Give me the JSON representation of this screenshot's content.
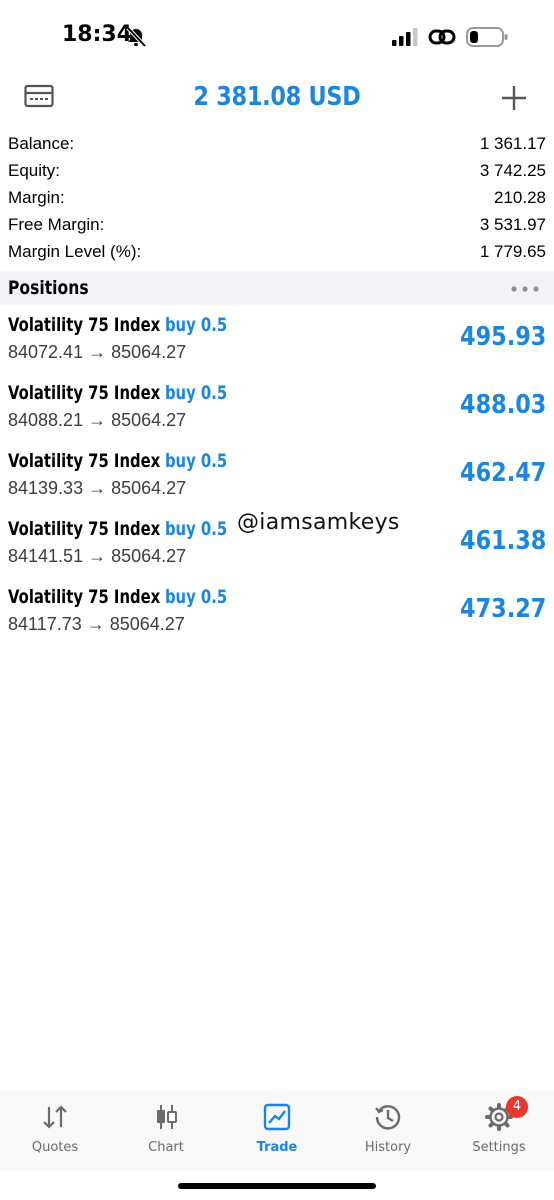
{
  "status_bar": {
    "time": "18:34"
  },
  "header": {
    "title": "2 381.08 USD",
    "accent_color": "#1a86e0"
  },
  "summary": [
    {
      "label": "Balance:",
      "value": "1 361.17"
    },
    {
      "label": "Equity:",
      "value": "3 742.25"
    },
    {
      "label": "Margin:",
      "value": "210.28"
    },
    {
      "label": "Free Margin:",
      "value": "3 531.97"
    },
    {
      "label": "Margin Level (%):",
      "value": "1 779.65"
    }
  ],
  "positions": {
    "title": "Positions",
    "items": [
      {
        "symbol": "Volatility 75 Index",
        "side": "buy 0.5",
        "prices": "84072.41 → 85064.27",
        "profit": "495.93"
      },
      {
        "symbol": "Volatility 75 Index",
        "side": "buy 0.5",
        "prices": "84088.21 → 85064.27",
        "profit": "488.03"
      },
      {
        "symbol": "Volatility 75 Index",
        "side": "buy 0.5",
        "prices": "84139.33 → 85064.27",
        "profit": "462.47"
      },
      {
        "symbol": "Volatility 75 Index",
        "side": "buy 0.5",
        "prices": "84141.51 → 85064.27",
        "profit": "461.38"
      },
      {
        "symbol": "Volatility 75 Index",
        "side": "buy 0.5",
        "prices": "84117.73 → 85064.27",
        "profit": "473.27"
      }
    ]
  },
  "watermark": "@iamsamkeys",
  "tabs": [
    {
      "label": "Quotes",
      "icon": "quotes-icon"
    },
    {
      "label": "Chart",
      "icon": "chart-icon"
    },
    {
      "label": "Trade",
      "icon": "trade-icon",
      "active": true
    },
    {
      "label": "History",
      "icon": "history-icon"
    },
    {
      "label": "Settings",
      "icon": "gear-icon",
      "badge": "4"
    }
  ]
}
